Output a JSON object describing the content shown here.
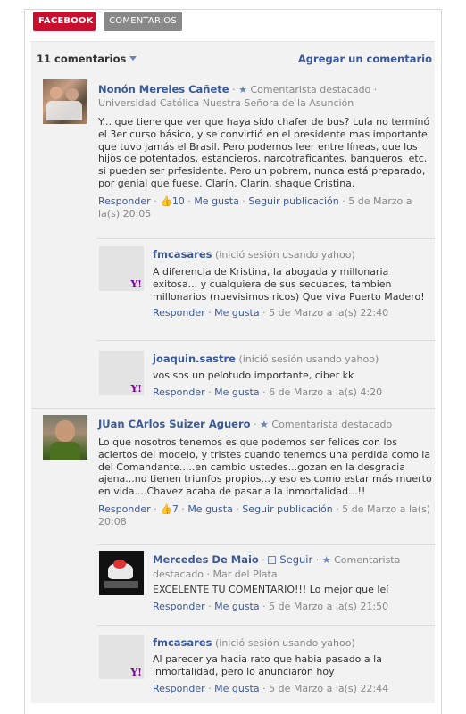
{
  "tabs": {
    "facebook": "FACEBOOK",
    "comments": "COMENTARIOS"
  },
  "header": {
    "count": "11 comentarios",
    "add": "Agregar un comentario"
  },
  "labels": {
    "reply": "Responder",
    "like": "Me gusta",
    "follow_post": "Seguir publicación",
    "follow": "Seguir",
    "featured": "Comentarista destacado",
    "yahoo_login": "(inició sesión usando yahoo)",
    "yahoo_badge": "Y!"
  },
  "comments": [
    {
      "name": "Nonón Mereles Cañete",
      "affiliation": "Universidad Católica Nuestra Señora de la Asunción",
      "text": "Y... que tiene que ver que haya sido chafer de bus? Lula no terminó el 3er curso básico, y se convirtió en el presidente mas importante que tuvo jamás el Brasil. Pero podemos leer entre líneas, que los hijos de potentados, estancieros, narcotraficantes, banqueros, etc. si pueden ser prfesidente. Pero un pobrem, nunca está preparado, por genial que fuese. Clarín, Clarín, shaque Cristina.",
      "likes": "10",
      "date": "5 de Marzo a la(s) 20:05",
      "replies": [
        {
          "name": "fmcasares",
          "text": "A diferencia de Kristina, la abogada y millonaria exitosa... y cualquiera de sus secuaces, tambien millonarios (nuevisimos ricos) Que viva Puerto Madero!",
          "date": "5 de Marzo a la(s) 22:40"
        },
        {
          "name": "joaquin.sastre",
          "text": "vos sos un pelotudo importante, ciber kk",
          "date": "6 de Marzo a la(s) 4:20"
        }
      ]
    },
    {
      "name": "JUan CArlos Suizer Aguero",
      "text": "Lo que nosotros tenemos es que podemos ser felices con los aciertos del modelo, y tristes cuando tenemos una perdida como la del Comandante.....en cambio ustedes...gozan en la desgracia ajena...no tienen triunfos propios...y eso es como estar más muerto en vida....Chavez acaba de pasar a la inmortalidad...!!",
      "likes": "7",
      "date": "5 de Marzo a la(s) 20:08",
      "replies": [
        {
          "name": "Mercedes De Maio",
          "location": "Mar del Plata",
          "text": "EXCELENTE TU COMENTARIO!!! Lo mejor que leí",
          "date": "5 de Marzo a la(s) 21:50"
        },
        {
          "name": "fmcasares",
          "text": "Al parecer ya hacia rato que habia pasado a la inmortalidad, pero lo anunciaron hoy",
          "date": "5 de Marzo a la(s) 22:44"
        }
      ]
    }
  ]
}
